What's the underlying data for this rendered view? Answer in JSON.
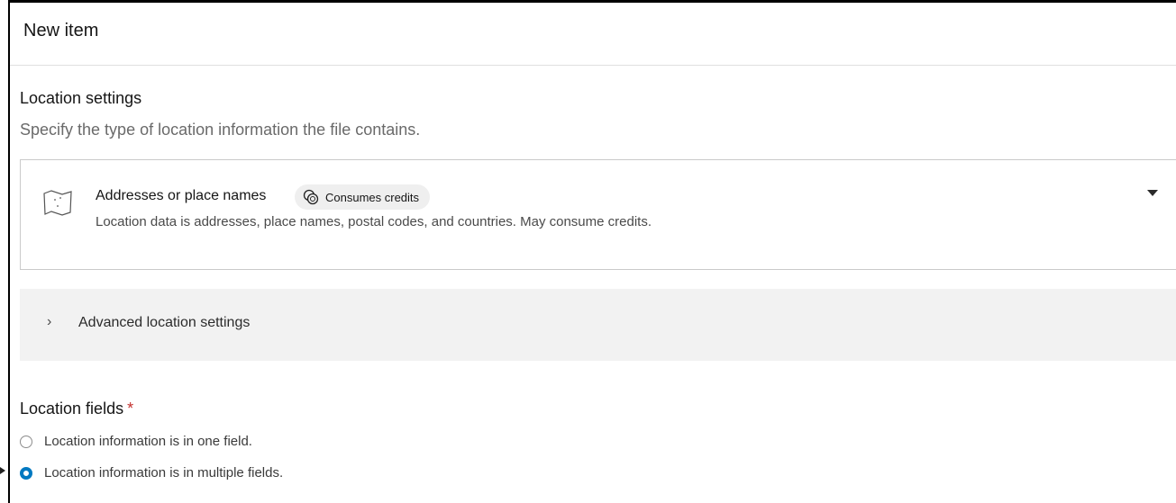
{
  "header": {
    "title": "New item"
  },
  "location_settings": {
    "title": "Location settings",
    "description": "Specify the type of location information the file contains."
  },
  "location_type": {
    "selected_title": "Addresses or place names",
    "badge_label": "Consumes credits",
    "selected_description": "Location data is addresses, place names, postal codes, and countries. May consume credits.",
    "icon": "map-icon",
    "badge_icon": "credits-icon",
    "caret_icon": "caret-down-icon"
  },
  "advanced": {
    "label": "Advanced location settings",
    "chevron": "›"
  },
  "location_fields": {
    "title": "Location fields",
    "required_marker": "*",
    "options": [
      {
        "label": "Location information is in one field.",
        "checked": false
      },
      {
        "label": "Location information is in multiple fields.",
        "checked": true
      }
    ]
  },
  "colors": {
    "accent": "#0079c1",
    "required": "#c4312e",
    "panel_background": "#f2f2f2"
  }
}
